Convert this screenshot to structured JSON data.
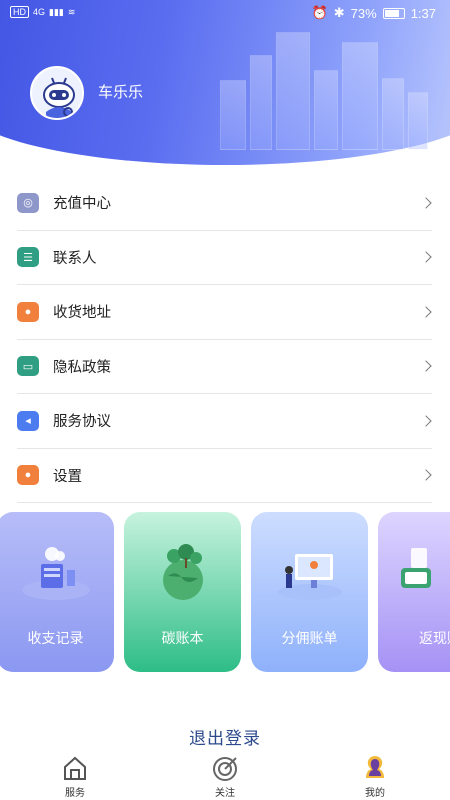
{
  "status_bar": {
    "left_chips": [
      "HD",
      "4G"
    ],
    "battery": "73%",
    "time": "1:37"
  },
  "profile": {
    "username": "车乐乐"
  },
  "menu": [
    {
      "label": "充值中心",
      "icon": "recharge-icon",
      "color": "#8e97c9"
    },
    {
      "label": "联系人",
      "icon": "contacts-icon",
      "color": "#2f9e83"
    },
    {
      "label": "收货地址",
      "icon": "address-icon",
      "color": "#f0803c"
    },
    {
      "label": "隐私政策",
      "icon": "privacy-icon",
      "color": "#2f9e83"
    },
    {
      "label": "服务协议",
      "icon": "agreement-icon",
      "color": "#4d7cf0"
    },
    {
      "label": "设置",
      "icon": "settings-icon",
      "color": "#f0803c"
    }
  ],
  "cards": [
    {
      "label": "收支记录",
      "icon": "ledger-illustration",
      "gradient": [
        "#b7bdf8",
        "#8b98f1"
      ]
    },
    {
      "label": "碳账本",
      "icon": "carbon-illustration",
      "gradient": [
        "#b9f0d6",
        "#2ebd87"
      ]
    },
    {
      "label": "分佣账单",
      "icon": "commission-illustration",
      "gradient": [
        "#c3d5ff",
        "#8fb1fb"
      ]
    },
    {
      "label": "返现账",
      "icon": "cashback-illustration",
      "gradient": [
        "#d9d2ff",
        "#a592f5"
      ]
    }
  ],
  "logout_label": "退出登录",
  "tabs": [
    {
      "label": "服务",
      "icon": "home-icon"
    },
    {
      "label": "关注",
      "icon": "target-icon"
    },
    {
      "label": "我的",
      "icon": "user-icon",
      "active": true
    }
  ]
}
